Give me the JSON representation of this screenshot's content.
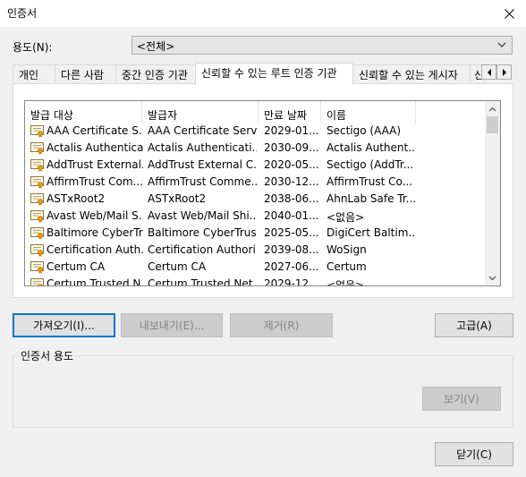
{
  "window": {
    "title": "인증서"
  },
  "purpose": {
    "label": "용도(N):",
    "selected": "<전체>"
  },
  "tabs": [
    {
      "label": "개인"
    },
    {
      "label": "다른 사람"
    },
    {
      "label": "중간 인증 기관"
    },
    {
      "label": "신뢰할 수 있는 루트 인증 기관"
    },
    {
      "label": "신뢰할 수 있는 게시자"
    },
    {
      "label": "신"
    }
  ],
  "table": {
    "columns": [
      "발급 대상",
      "발급자",
      "만료 날짜",
      "이름"
    ],
    "rows": [
      [
        "AAA Certificate S...",
        "AAA Certificate Serv...",
        "2029-01...",
        "Sectigo (AAA)"
      ],
      [
        "Actalis Authentica...",
        "Actalis Authenticati...",
        "2030-09...",
        "Actalis Authent..."
      ],
      [
        "AddTrust External...",
        "AddTrust External C...",
        "2020-05...",
        "Sectigo (AddTr..."
      ],
      [
        "AffirmTrust Com...",
        "AffirmTrust Comme...",
        "2030-12...",
        "AffirmTrust Co..."
      ],
      [
        "ASTxRoot2",
        "ASTxRoot2",
        "2038-06...",
        "AhnLab Safe Tr..."
      ],
      [
        "Avast Web/Mail S...",
        "Avast Web/Mail Shi...",
        "2040-01...",
        "<없음>"
      ],
      [
        "Baltimore CyberTr...",
        "Baltimore CyberTrus...",
        "2025-05...",
        "DigiCert Baltim..."
      ],
      [
        "Certification Auth...",
        "Certification Authori...",
        "2039-08...",
        "WoSign"
      ],
      [
        "Certum CA",
        "Certum CA",
        "2027-06...",
        "Certum"
      ],
      [
        "Certum Trusted N...",
        "Certum Trusted Net...",
        "2029-12...",
        "<없음>"
      ]
    ]
  },
  "buttons": {
    "import": "가져오기(I)...",
    "export": "내보내기(E)...",
    "remove": "제거(R)",
    "advanced": "고급(A)",
    "view": "보기(V)",
    "close": "닫기(C)"
  },
  "group": {
    "label": "인증서 용도"
  },
  "icons": {
    "close": "close-icon",
    "dropdown": "chevron-down-icon",
    "tab_left": "arrow-left-icon",
    "tab_right": "arrow-right-icon",
    "certificate": "certificate-icon",
    "scroll_up": "chevron-up-icon",
    "scroll_down": "chevron-down-icon"
  },
  "colors": {
    "accent": "#0078d7",
    "window_bg": "#f0f0f0"
  }
}
